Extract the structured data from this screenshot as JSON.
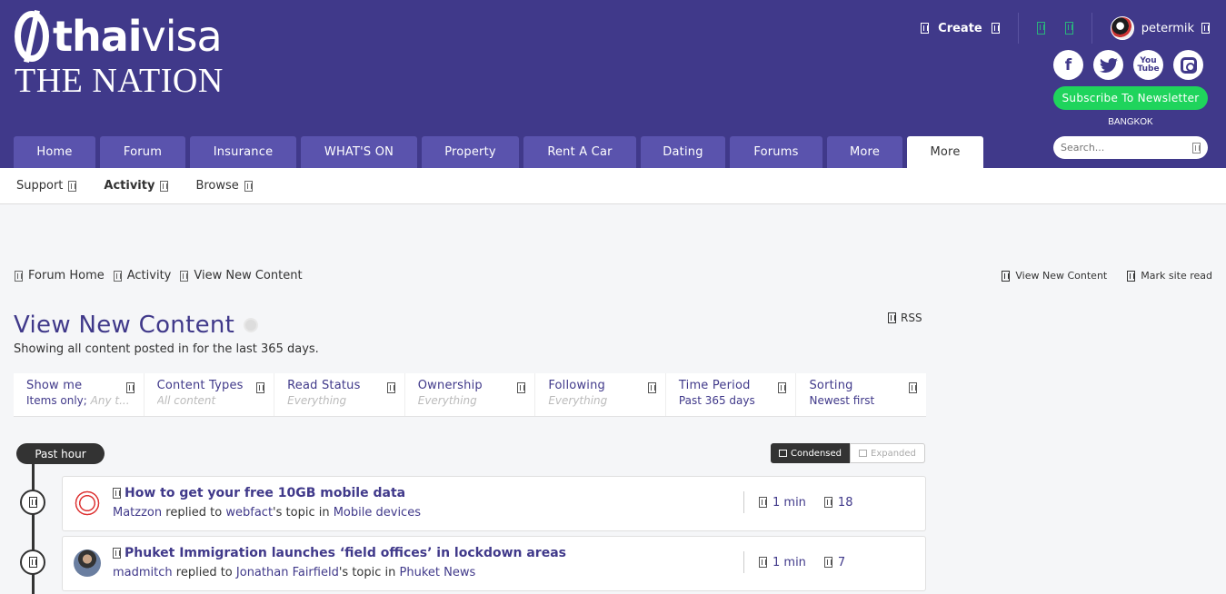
{
  "logo": {
    "brand_bold": "thai",
    "brand_light": "visa",
    "sub": "THE NATION"
  },
  "user_bar": {
    "create_label": "Create",
    "username": "petermik"
  },
  "newsletter_label": "Subscribe To Newsletter",
  "location": "BANGKOK",
  "search": {
    "placeholder": "Search..."
  },
  "social": {
    "facebook": "f",
    "youtube": "You Tube"
  },
  "nav": [
    "Home",
    "Forum",
    "Insurance",
    "WHAT'S ON",
    "Property",
    "Rent A Car",
    "Dating",
    "Forums",
    "More",
    "More"
  ],
  "subnav": [
    "Support",
    "Activity",
    "Browse"
  ],
  "breadcrumb": [
    "Forum Home",
    "Activity",
    "View New Content"
  ],
  "page_actions": [
    "View New Content",
    "Mark site read"
  ],
  "title": "View New Content",
  "rss_label": "RSS",
  "subtitle": "Showing all content posted in for the last 365 days.",
  "filters": [
    {
      "label": "Show me",
      "value": "Items only;",
      "extra": "Any t..."
    },
    {
      "label": "Content Types",
      "value": "All content"
    },
    {
      "label": "Read Status",
      "value": "Everything"
    },
    {
      "label": "Ownership",
      "value": "Everything"
    },
    {
      "label": "Following",
      "value": "Everything"
    },
    {
      "label": "Time Period",
      "value": "Past 365 days"
    },
    {
      "label": "Sorting",
      "value": "Newest first"
    }
  ],
  "period_label": "Past hour",
  "view_toggle": {
    "condensed": "Condensed",
    "expanded": "Expanded"
  },
  "entries": [
    {
      "title": "How to get your free 10GB mobile data",
      "user": "Matzzon",
      "action": "replied to",
      "owner": "webfact",
      "owner_suffix": "'s topic in",
      "forum": "Mobile devices",
      "time": "1 min",
      "replies": "18"
    },
    {
      "title": "Phuket Immigration launches ‘field offices’ in lockdown areas",
      "user": "madmitch",
      "action": "replied to",
      "owner": "Jonathan Fairfield",
      "owner_suffix": "'s topic in",
      "forum": "Phuket News",
      "time": "1 min",
      "replies": "7"
    }
  ]
}
